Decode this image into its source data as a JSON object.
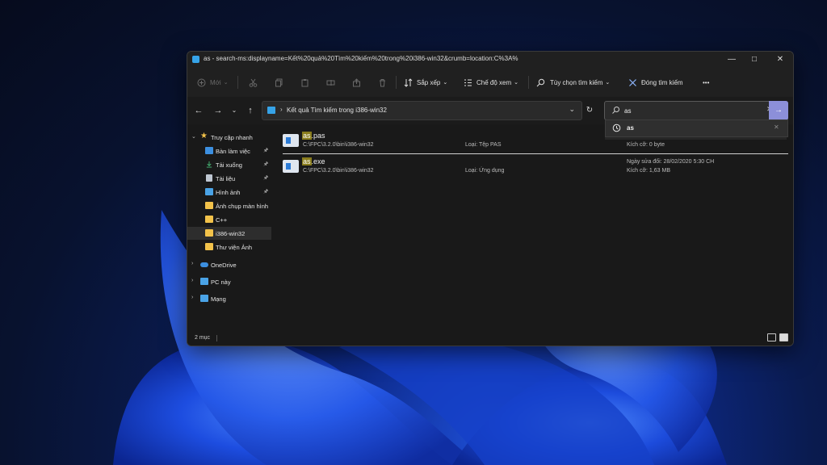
{
  "window": {
    "title": "as - search-ms:displayname=Kết%20quả%20Tìm%20kiếm%20trong%20i386-win32&crumb=location:C%3A%"
  },
  "toolbar": {
    "new_label": "Mới",
    "sort_label": "Sắp xếp",
    "view_label": "Chế độ xem",
    "search_options_label": "Tùy chọn tìm kiếm",
    "close_search_label": "Đóng tìm kiếm",
    "more_label": "•••"
  },
  "address": {
    "path": "Kết quả Tìm kiếm trong i386-win32"
  },
  "search": {
    "value": "as",
    "suggestion": "as"
  },
  "sidebar": {
    "quick_access": "Truy cập nhanh",
    "items": [
      {
        "label": "Bàn làm việc",
        "icon": "desktop-icon",
        "pinned": true
      },
      {
        "label": "Tải xuống",
        "icon": "download-icon",
        "pinned": true
      },
      {
        "label": "Tài liệu",
        "icon": "document-icon",
        "pinned": true
      },
      {
        "label": "Hình ảnh",
        "icon": "pictures-icon",
        "pinned": true
      },
      {
        "label": "Ảnh chụp màn hình",
        "icon": "folder-icon",
        "pinned": false
      },
      {
        "label": "C++",
        "icon": "folder-icon",
        "pinned": false
      },
      {
        "label": "i386-win32",
        "icon": "folder-icon",
        "pinned": false,
        "selected": true
      },
      {
        "label": "Thư viện Ảnh",
        "icon": "folder-icon",
        "pinned": false
      }
    ],
    "onedrive": "OneDrive",
    "this_pc": "PC này",
    "network": "Mạng"
  },
  "results": [
    {
      "highlight": "as",
      "rest": ".pas",
      "path": "C:\\FPC\\3.2.0\\bin\\i386-win32",
      "type": "Loại: Tệp PAS",
      "date": "",
      "size": "Kích cỡ: 0 byte"
    },
    {
      "highlight": "as",
      "rest": ".exe",
      "path": "C:\\FPC\\3.2.0\\bin\\i386-win32",
      "type": "Loại: Ứng dụng",
      "date": "Ngày sửa đổi: 28/02/2020 5:30 CH",
      "size": "Kích cỡ: 1,63 MB"
    }
  ],
  "status": {
    "count": "2 mục"
  },
  "colors": {
    "accent": "#8c8fd9",
    "folder": "#f2c24a",
    "highlight": "#8a7d1d",
    "window_bg": "#191919"
  }
}
